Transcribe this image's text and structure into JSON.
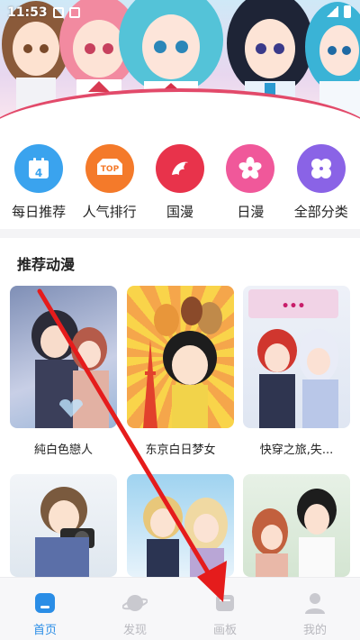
{
  "status_bar": {
    "time": "11:53"
  },
  "categories": [
    {
      "label": "每日推荐",
      "icon": "calendar-icon",
      "color": "#3aa3ee",
      "badge": "4"
    },
    {
      "label": "人气排行",
      "icon": "top-ranking-icon",
      "color": "#f47a2a",
      "badge": "TOP"
    },
    {
      "label": "国漫",
      "icon": "phoenix-icon",
      "color": "#e8334b"
    },
    {
      "label": "日漫",
      "icon": "sakura-icon",
      "color": "#f0589a"
    },
    {
      "label": "全部分类",
      "icon": "clover-grid-icon",
      "color": "#8a63e6"
    }
  ],
  "recommend": {
    "title": "推荐动漫",
    "items": [
      {
        "title": "純白色戀人"
      },
      {
        "title": "东京白日梦女"
      },
      {
        "title": "快穿之旅,失..."
      },
      {
        "title": ""
      },
      {
        "title": ""
      },
      {
        "title": ""
      }
    ]
  },
  "nav": [
    {
      "label": "首页",
      "icon": "home-icon",
      "active": true
    },
    {
      "label": "发现",
      "icon": "planet-icon",
      "active": false
    },
    {
      "label": "画板",
      "icon": "palette-board-icon",
      "active": false
    },
    {
      "label": "我的",
      "icon": "user-icon",
      "active": false
    }
  ],
  "colors": {
    "accent": "#2a8de6",
    "annotation_arrow": "#e51c1c",
    "banner_stripe": "#e24a6a"
  }
}
